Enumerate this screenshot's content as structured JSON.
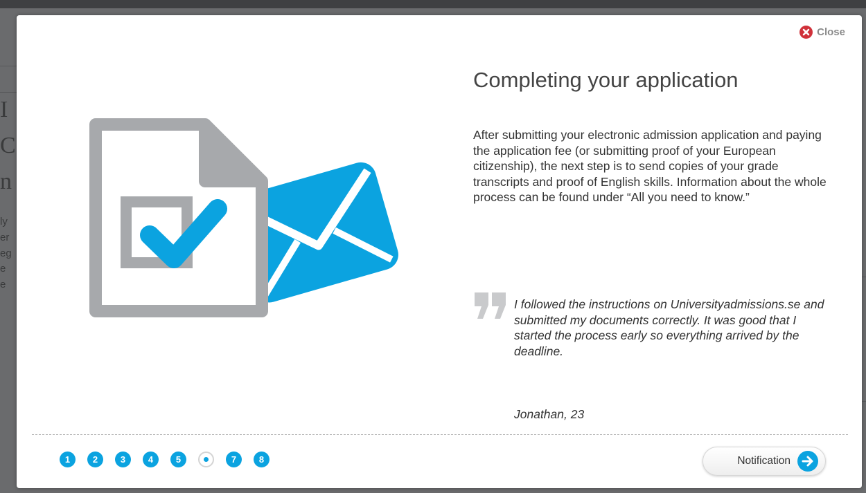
{
  "modal": {
    "close_label": "Close",
    "title": "Completing your application",
    "body": "After submitting your electronic admission application and paying the application fee (or submitting proof of your European citizenship), the next step is to send copies of your grade transcripts and proof of English skills. Information about the whole process can be found under “All you need to know.”",
    "quote": "I followed the instructions on Universityadmissions.se and submitted my documents correctly. It was good that I started the process early so everything arrived by the deadline.",
    "quote_author": "Jonathan, 23",
    "pager": [
      "1",
      "2",
      "3",
      "4",
      "5",
      "6",
      "7",
      "8"
    ],
    "active_page": 6,
    "next_label": "Notification"
  },
  "background_text": {
    "glyphs": [
      "I",
      "C",
      "n",
      "ly",
      "er",
      "eg",
      "e",
      "e"
    ]
  },
  "colors": {
    "accent": "#0ba3e0",
    "close": "#d0313a",
    "document_gray": "#a7a9ac",
    "envelope": "#0ba3e0"
  }
}
